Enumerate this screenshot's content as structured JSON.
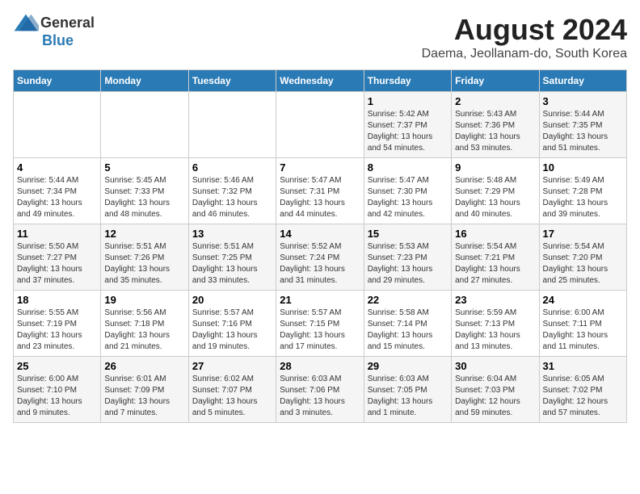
{
  "header": {
    "logo_general": "General",
    "logo_blue": "Blue",
    "month_title": "August 2024",
    "location": "Daema, Jeollanam-do, South Korea"
  },
  "weekdays": [
    "Sunday",
    "Monday",
    "Tuesday",
    "Wednesday",
    "Thursday",
    "Friday",
    "Saturday"
  ],
  "weeks": [
    [
      {
        "day": "",
        "info": ""
      },
      {
        "day": "",
        "info": ""
      },
      {
        "day": "",
        "info": ""
      },
      {
        "day": "",
        "info": ""
      },
      {
        "day": "1",
        "info": "Sunrise: 5:42 AM\nSunset: 7:37 PM\nDaylight: 13 hours\nand 54 minutes."
      },
      {
        "day": "2",
        "info": "Sunrise: 5:43 AM\nSunset: 7:36 PM\nDaylight: 13 hours\nand 53 minutes."
      },
      {
        "day": "3",
        "info": "Sunrise: 5:44 AM\nSunset: 7:35 PM\nDaylight: 13 hours\nand 51 minutes."
      }
    ],
    [
      {
        "day": "4",
        "info": "Sunrise: 5:44 AM\nSunset: 7:34 PM\nDaylight: 13 hours\nand 49 minutes."
      },
      {
        "day": "5",
        "info": "Sunrise: 5:45 AM\nSunset: 7:33 PM\nDaylight: 13 hours\nand 48 minutes."
      },
      {
        "day": "6",
        "info": "Sunrise: 5:46 AM\nSunset: 7:32 PM\nDaylight: 13 hours\nand 46 minutes."
      },
      {
        "day": "7",
        "info": "Sunrise: 5:47 AM\nSunset: 7:31 PM\nDaylight: 13 hours\nand 44 minutes."
      },
      {
        "day": "8",
        "info": "Sunrise: 5:47 AM\nSunset: 7:30 PM\nDaylight: 13 hours\nand 42 minutes."
      },
      {
        "day": "9",
        "info": "Sunrise: 5:48 AM\nSunset: 7:29 PM\nDaylight: 13 hours\nand 40 minutes."
      },
      {
        "day": "10",
        "info": "Sunrise: 5:49 AM\nSunset: 7:28 PM\nDaylight: 13 hours\nand 39 minutes."
      }
    ],
    [
      {
        "day": "11",
        "info": "Sunrise: 5:50 AM\nSunset: 7:27 PM\nDaylight: 13 hours\nand 37 minutes."
      },
      {
        "day": "12",
        "info": "Sunrise: 5:51 AM\nSunset: 7:26 PM\nDaylight: 13 hours\nand 35 minutes."
      },
      {
        "day": "13",
        "info": "Sunrise: 5:51 AM\nSunset: 7:25 PM\nDaylight: 13 hours\nand 33 minutes."
      },
      {
        "day": "14",
        "info": "Sunrise: 5:52 AM\nSunset: 7:24 PM\nDaylight: 13 hours\nand 31 minutes."
      },
      {
        "day": "15",
        "info": "Sunrise: 5:53 AM\nSunset: 7:23 PM\nDaylight: 13 hours\nand 29 minutes."
      },
      {
        "day": "16",
        "info": "Sunrise: 5:54 AM\nSunset: 7:21 PM\nDaylight: 13 hours\nand 27 minutes."
      },
      {
        "day": "17",
        "info": "Sunrise: 5:54 AM\nSunset: 7:20 PM\nDaylight: 13 hours\nand 25 minutes."
      }
    ],
    [
      {
        "day": "18",
        "info": "Sunrise: 5:55 AM\nSunset: 7:19 PM\nDaylight: 13 hours\nand 23 minutes."
      },
      {
        "day": "19",
        "info": "Sunrise: 5:56 AM\nSunset: 7:18 PM\nDaylight: 13 hours\nand 21 minutes."
      },
      {
        "day": "20",
        "info": "Sunrise: 5:57 AM\nSunset: 7:16 PM\nDaylight: 13 hours\nand 19 minutes."
      },
      {
        "day": "21",
        "info": "Sunrise: 5:57 AM\nSunset: 7:15 PM\nDaylight: 13 hours\nand 17 minutes."
      },
      {
        "day": "22",
        "info": "Sunrise: 5:58 AM\nSunset: 7:14 PM\nDaylight: 13 hours\nand 15 minutes."
      },
      {
        "day": "23",
        "info": "Sunrise: 5:59 AM\nSunset: 7:13 PM\nDaylight: 13 hours\nand 13 minutes."
      },
      {
        "day": "24",
        "info": "Sunrise: 6:00 AM\nSunset: 7:11 PM\nDaylight: 13 hours\nand 11 minutes."
      }
    ],
    [
      {
        "day": "25",
        "info": "Sunrise: 6:00 AM\nSunset: 7:10 PM\nDaylight: 13 hours\nand 9 minutes."
      },
      {
        "day": "26",
        "info": "Sunrise: 6:01 AM\nSunset: 7:09 PM\nDaylight: 13 hours\nand 7 minutes."
      },
      {
        "day": "27",
        "info": "Sunrise: 6:02 AM\nSunset: 7:07 PM\nDaylight: 13 hours\nand 5 minutes."
      },
      {
        "day": "28",
        "info": "Sunrise: 6:03 AM\nSunset: 7:06 PM\nDaylight: 13 hours\nand 3 minutes."
      },
      {
        "day": "29",
        "info": "Sunrise: 6:03 AM\nSunset: 7:05 PM\nDaylight: 13 hours\nand 1 minute."
      },
      {
        "day": "30",
        "info": "Sunrise: 6:04 AM\nSunset: 7:03 PM\nDaylight: 12 hours\nand 59 minutes."
      },
      {
        "day": "31",
        "info": "Sunrise: 6:05 AM\nSunset: 7:02 PM\nDaylight: 12 hours\nand 57 minutes."
      }
    ]
  ]
}
